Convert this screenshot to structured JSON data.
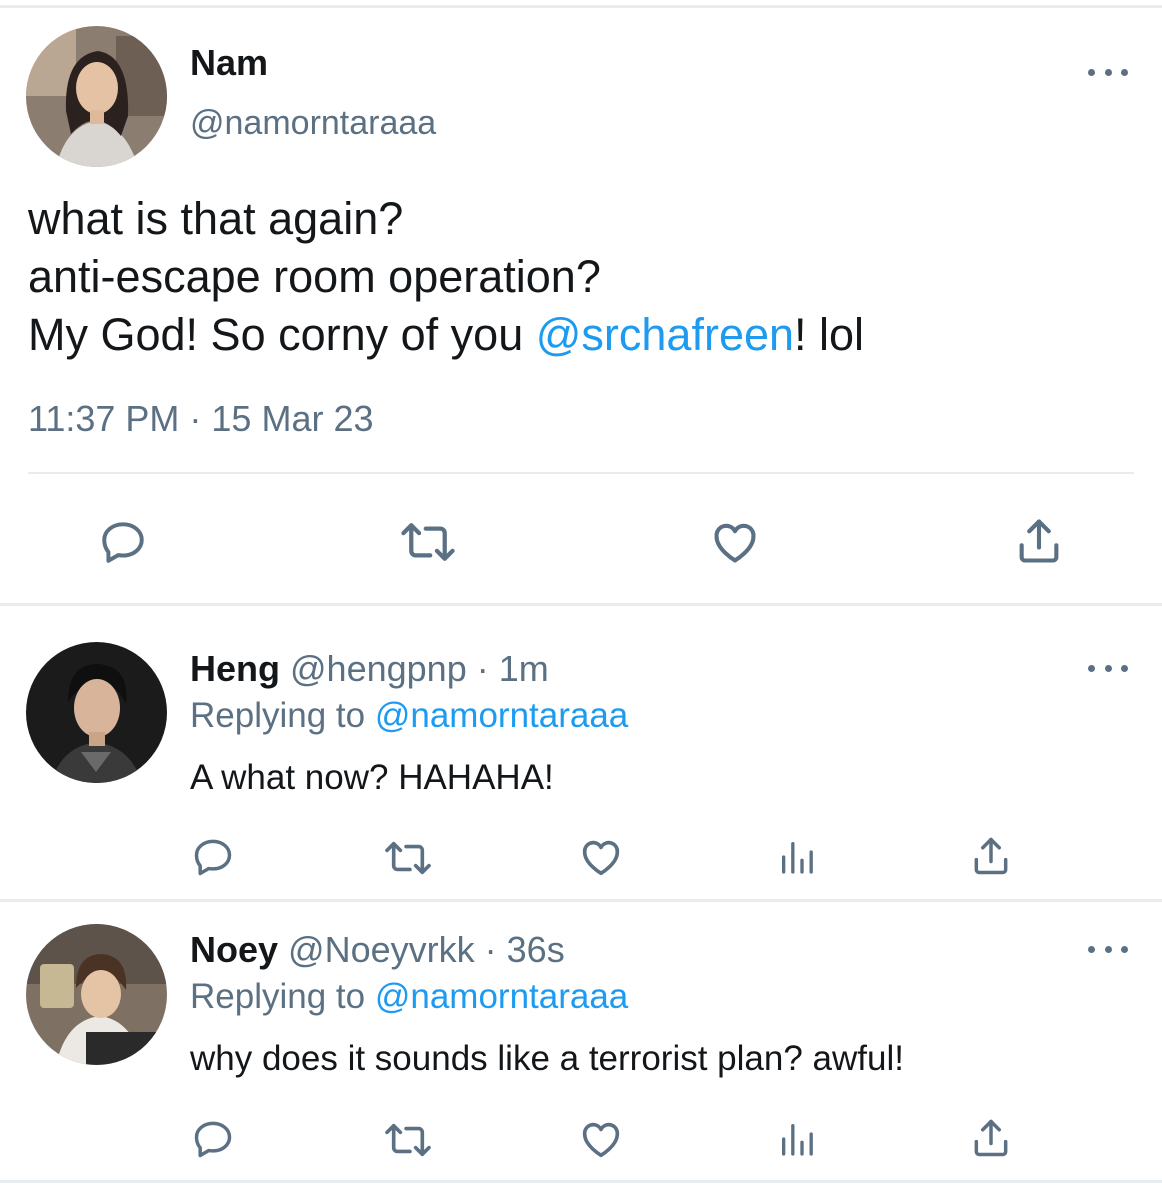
{
  "main_tweet": {
    "display_name": "Nam",
    "handle": "@namorntaraaa",
    "lines": [
      "what is that again?",
      "anti-escape room operation?"
    ],
    "line3_pre": "My God! So corny of you ",
    "mention": "@srchafreen",
    "line3_post": "! lol",
    "timestamp": "11:37 PM · 15 Mar 23",
    "actions": [
      "reply-icon",
      "retweet-icon",
      "like-icon",
      "share-icon"
    ]
  },
  "replies": [
    {
      "display_name": "Heng",
      "handle": "@hengpnp",
      "separator": "·",
      "time": "1m",
      "replying_label": "Replying to ",
      "replying_to": "@namorntaraaa",
      "text": "A what now? HAHAHA!",
      "actions": [
        "reply-icon",
        "retweet-icon",
        "like-icon",
        "analytics-icon",
        "share-icon"
      ]
    },
    {
      "display_name": "Noey",
      "handle": "@Noeyvrkk",
      "separator": "·",
      "time": "36s",
      "replying_label": "Replying to ",
      "replying_to": "@namorntaraaa",
      "text": "why does it sounds like a terrorist plan? awful!",
      "actions": [
        "reply-icon",
        "retweet-icon",
        "like-icon",
        "analytics-icon",
        "share-icon"
      ]
    }
  ],
  "colors": {
    "link": "#1d9bf0",
    "secondary_text": "#5b7083",
    "divider": "#e6ecf0",
    "icon": "#5b7083"
  }
}
